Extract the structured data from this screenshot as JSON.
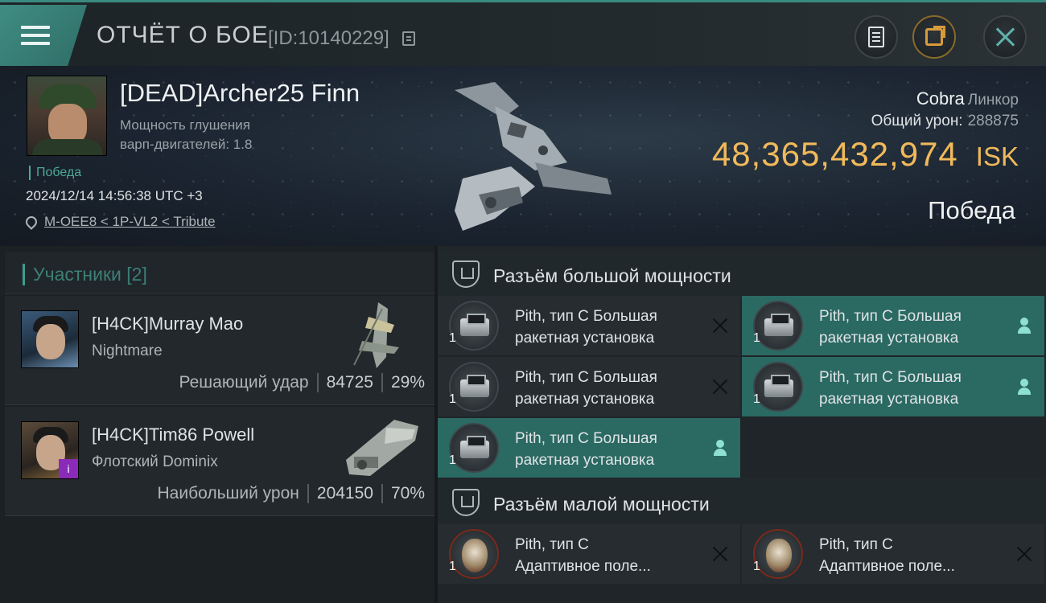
{
  "header": {
    "title": "ОТЧЁТ О БОЕ",
    "report_id": "[ID:10140229]"
  },
  "victim": {
    "name": "[DEAD]Archer25 Finn",
    "stat_line1": "Мощность глушения",
    "stat_line2": "варп-двигателей: 1.8",
    "result_tag": "Победа",
    "datetime": "2024/12/14 14:56:38 UTC +3",
    "location": "M-OEE8 < 1P-VL2 < Tribute",
    "ship_name": "Cobra",
    "ship_class": "Линкор",
    "total_damage_label": "Общий урон:",
    "total_damage": "288875",
    "isk_value": "48,365,432,974",
    "isk_currency": "ISK",
    "result": "Победа"
  },
  "participants": {
    "header": "Участники [2]",
    "items": [
      {
        "name": "[H4CK]Murray Mao",
        "ship": "Nightmare",
        "role": "Решающий удар",
        "damage": "84725",
        "percent": "29%"
      },
      {
        "name": "[H4CK]Tim86 Powell",
        "ship": "Флотский Dominix",
        "role": "Наибольший урон",
        "damage": "204150",
        "percent": "70%",
        "badge": "i"
      }
    ]
  },
  "fitting": {
    "high_slot_title": "Разъём большой мощности",
    "low_slot_title": "Разъём малой мощности",
    "high_slots": [
      {
        "qty": "1",
        "line1": "Pith, тип C Большая",
        "line2": "ракетная установка",
        "state": "destroyed"
      },
      {
        "qty": "1",
        "line1": "Pith, тип C Большая",
        "line2": "ракетная установка",
        "state": "dropped"
      },
      {
        "qty": "1",
        "line1": "Pith, тип C Большая",
        "line2": "ракетная установка",
        "state": "destroyed"
      },
      {
        "qty": "1",
        "line1": "Pith, тип C Большая",
        "line2": "ракетная установка",
        "state": "dropped"
      },
      {
        "qty": "1",
        "line1": "Pith, тип C Большая",
        "line2": "ракетная установка",
        "state": "dropped"
      }
    ],
    "low_slots": [
      {
        "qty": "1",
        "line1": "Pith, тип C",
        "line2": "Адаптивное поле...",
        "state": "destroyed"
      },
      {
        "qty": "1",
        "line1": "Pith, тип C",
        "line2": "Адаптивное поле...",
        "state": "destroyed"
      }
    ]
  },
  "colors": {
    "accent": "#3f8c83",
    "isk": "#f0b95a",
    "dropped_module_bg": "#2b6963"
  },
  "icons": [
    "menu-icon",
    "copy-icon",
    "report-icon",
    "share-icon",
    "close-icon",
    "location-pin-icon",
    "slot-icon",
    "launcher-icon",
    "shield-module-icon",
    "destroyed-icon",
    "dropped-icon"
  ]
}
